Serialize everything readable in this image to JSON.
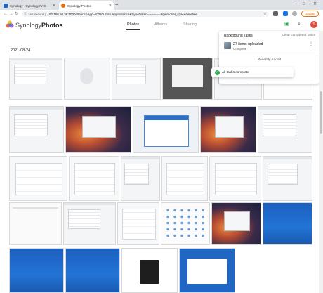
{
  "browser": {
    "tabs": [
      {
        "title": "Synology - Synology NAS",
        "favicon_color": "#1d63c8",
        "active": false
      },
      {
        "title": "Synology Photos",
        "favicon_color": "#e8710a",
        "active": true
      }
    ],
    "address": {
      "security_text": "Not secure",
      "url": "192.168.50.36:5000/?launchApp=SYNO.Foto.AppInstance&SynoToken=-----------#/personal_space/timeline"
    },
    "update_label": "Update"
  },
  "app": {
    "brand_prefix": "Synology",
    "brand_suffix": "Photos",
    "nav_tabs": [
      {
        "label": "Photos",
        "active": true
      },
      {
        "label": "Albums",
        "active": false
      },
      {
        "label": "Sharing",
        "active": false
      }
    ],
    "avatar_initial": "S",
    "colors": {
      "accent": "#e04a3f",
      "success": "#2ea84f"
    }
  },
  "timeline": {
    "date": "2021-08-24",
    "photo_count": 27
  },
  "background_tasks": {
    "title": "Background Tasks",
    "clear_label": "Clear completed tasks",
    "item": {
      "title": "27 items uploaded",
      "status": "Complete"
    },
    "recently_added_label": "Recently Added"
  },
  "toast": {
    "message": "All tasks complete"
  }
}
